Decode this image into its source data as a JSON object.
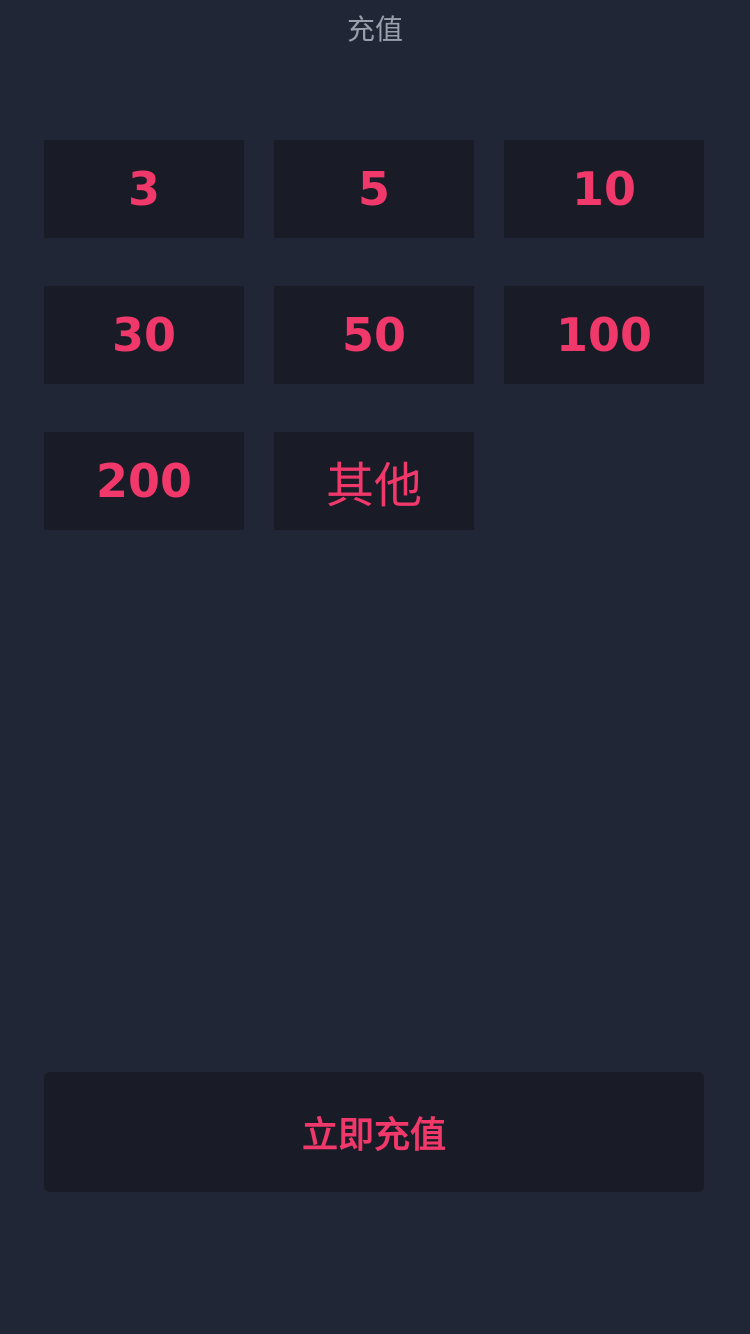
{
  "header": {
    "title": "充值"
  },
  "amounts": {
    "items": [
      {
        "label": "3"
      },
      {
        "label": "5"
      },
      {
        "label": "10"
      },
      {
        "label": "30"
      },
      {
        "label": "50"
      },
      {
        "label": "100"
      },
      {
        "label": "200"
      },
      {
        "label": "其他"
      }
    ]
  },
  "submit": {
    "label": "立即充值"
  },
  "colors": {
    "background": "#202635",
    "tile": "#191c27",
    "accent": "#f0386b",
    "title_text": "#9aa0ab"
  }
}
